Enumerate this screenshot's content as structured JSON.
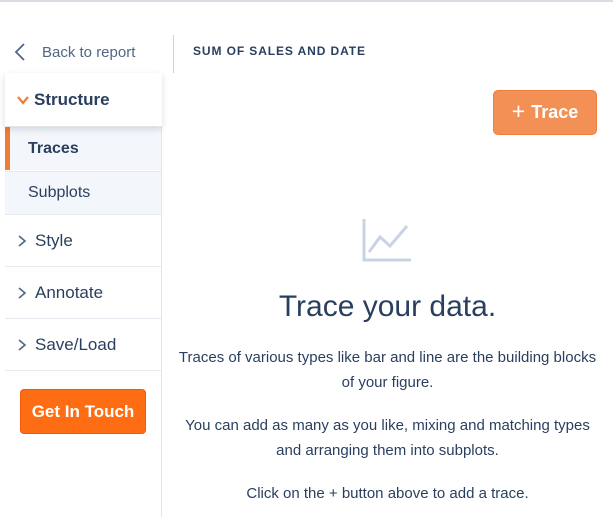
{
  "header": {
    "back_label": "Back to report",
    "title": "SUM OF SALES AND DATE"
  },
  "sidebar": {
    "sections": [
      {
        "label": "Structure",
        "expanded": true,
        "icon": "chevron-down-icon"
      },
      {
        "label": "Style",
        "expanded": false,
        "icon": "chevron-right-icon"
      },
      {
        "label": "Annotate",
        "expanded": false,
        "icon": "chevron-right-icon"
      },
      {
        "label": "Save/Load",
        "expanded": false,
        "icon": "chevron-right-icon"
      }
    ],
    "subitems": [
      {
        "label": "Traces",
        "active": true
      },
      {
        "label": "Subplots",
        "active": false
      }
    ],
    "cta_label": "Get In Touch"
  },
  "main": {
    "trace_button": {
      "plus": "+",
      "label": "Trace"
    },
    "empty_icon": "line-chart-icon",
    "title": "Trace your data.",
    "paragraphs": [
      "Traces of various types like bar and line are the building blocks of your figure.",
      "You can add as many as you like, mixing and matching types and arranging them into subplots.",
      "Click on the + button above to add a trace."
    ]
  },
  "colors": {
    "accent": "#ef7d34",
    "cta": "#fe6d14",
    "trace_button": "#f29055",
    "text": "#2a3f5f",
    "subitem_bg": "#f3f6fa",
    "icon": "#c8d4e3"
  }
}
